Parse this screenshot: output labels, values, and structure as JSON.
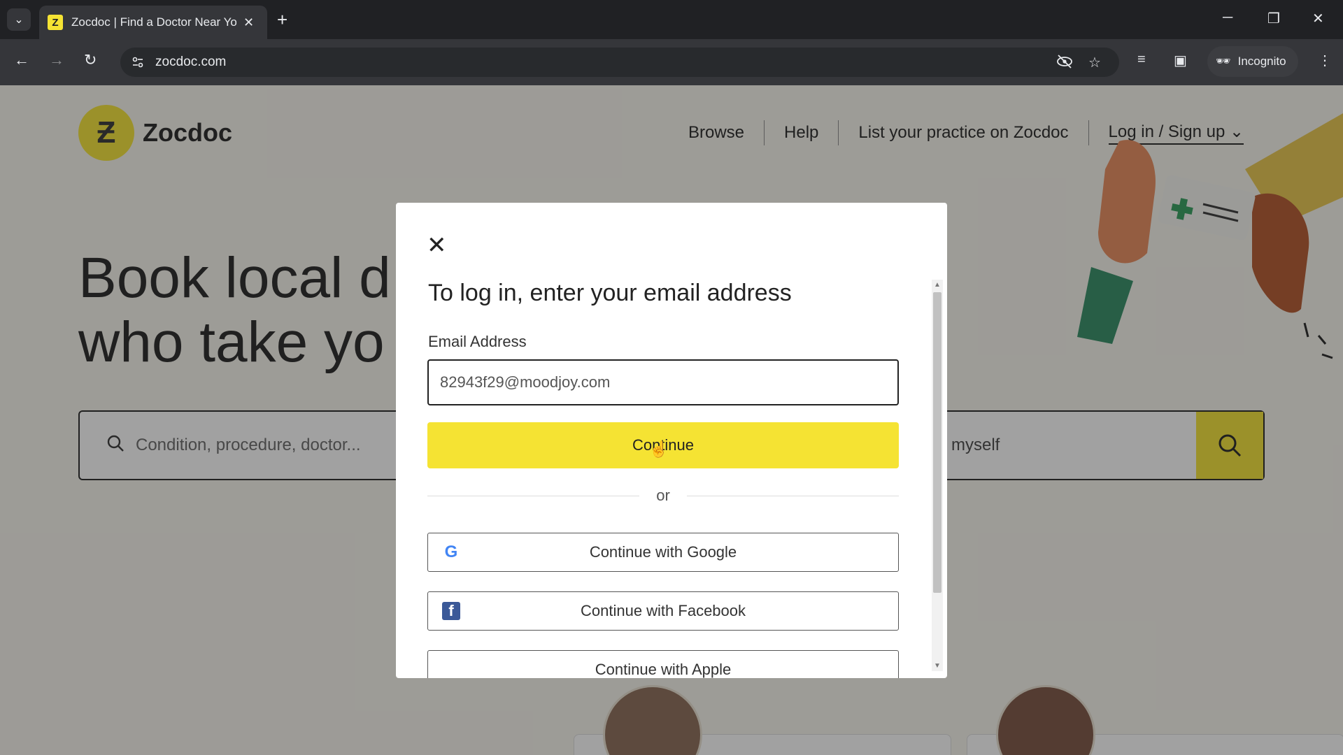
{
  "browser": {
    "tab_title": "Zocdoc | Find a Doctor Near Yo",
    "tab_favicon": "Z",
    "url": "zocdoc.com",
    "incognito_label": "Incognito"
  },
  "site": {
    "logo_text": "Zocdoc",
    "nav": {
      "browse": "Browse",
      "help": "Help",
      "list_practice": "List your practice on Zocdoc",
      "login": "Log in / Sign up"
    },
    "hero_line1": "Book local d",
    "hero_line2": "who take yo",
    "search_placeholder": "Condition, procedure, doctor...",
    "insurance_text": "myself"
  },
  "modal": {
    "heading": "To log in, enter your email address",
    "email_label": "Email Address",
    "email_value": "82943f29@moodjoy.com",
    "continue_label": "Continue",
    "or_label": "or",
    "google_label": "Continue with Google",
    "facebook_label": "Continue with Facebook",
    "apple_label": "Continue with Apple"
  },
  "colors": {
    "brand_yellow": "#f5e333",
    "facebook_blue": "#3b5998"
  }
}
